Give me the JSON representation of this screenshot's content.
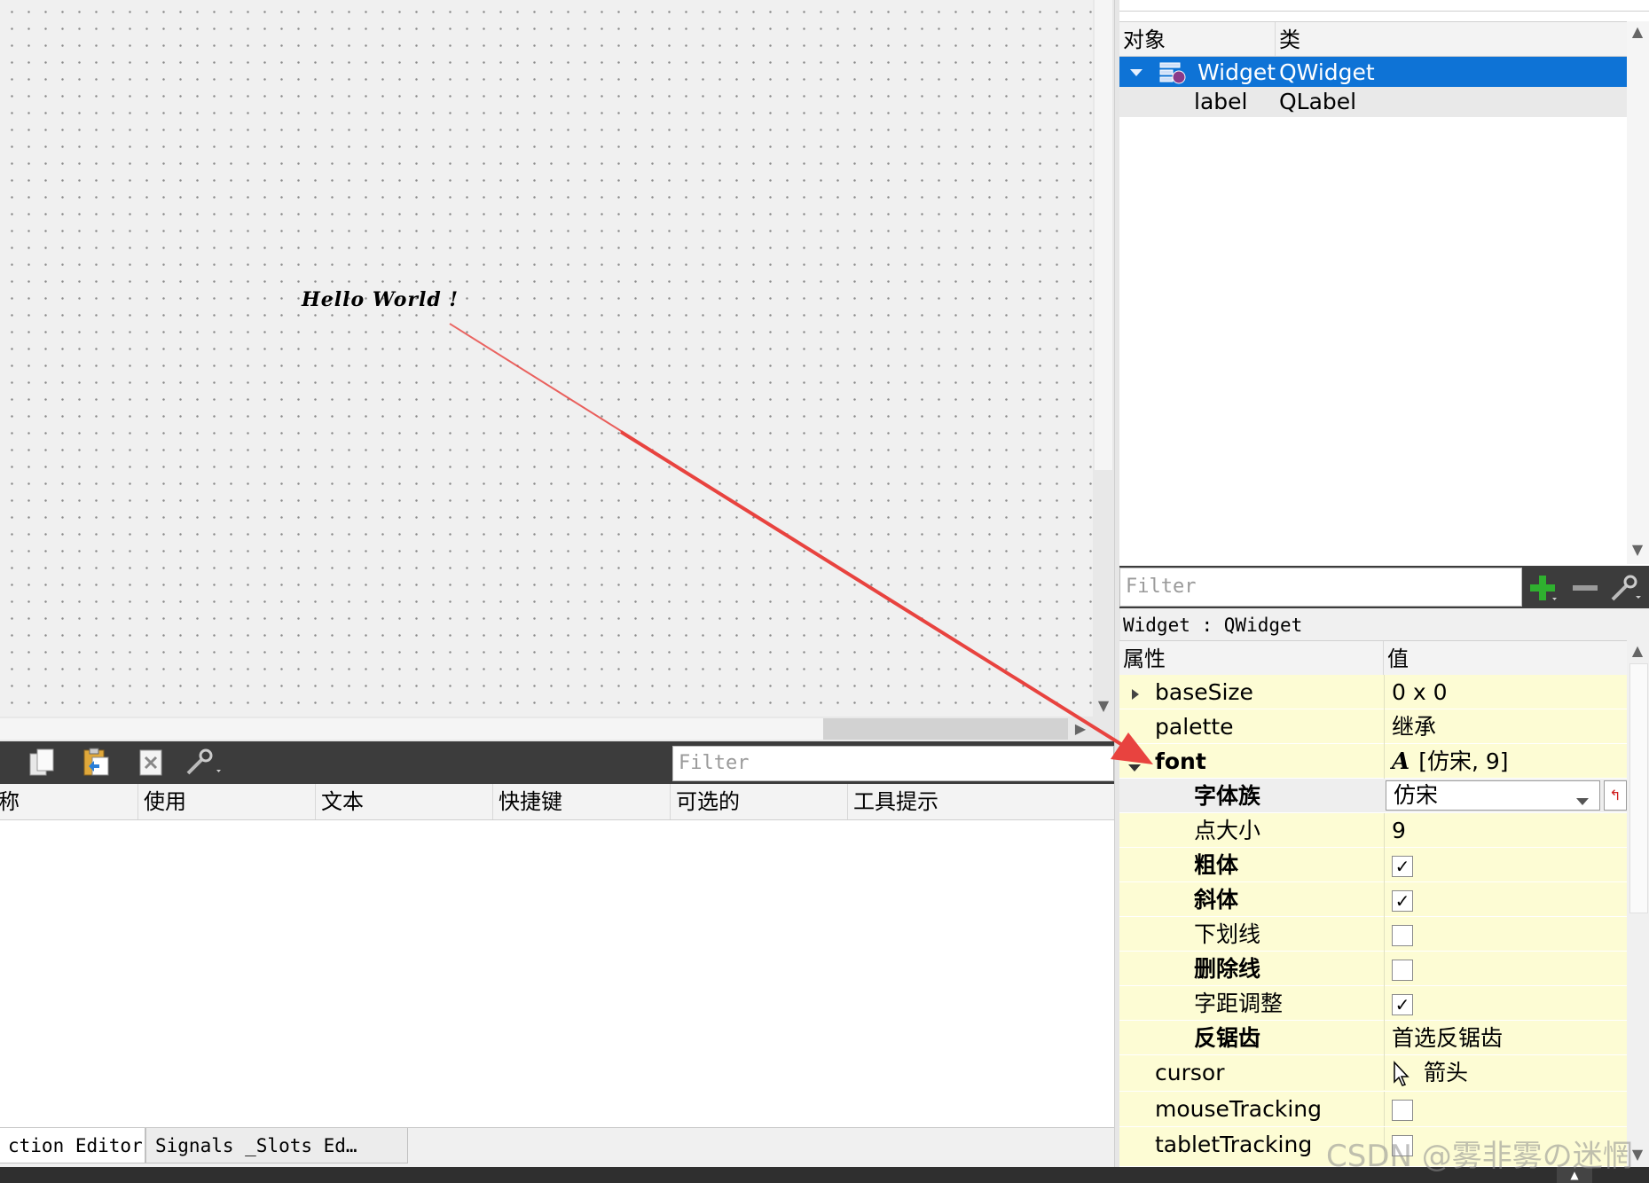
{
  "form_canvas": {
    "label_text": "Hello World !"
  },
  "action_editor": {
    "filter_placeholder": "Filter",
    "columns": [
      "称",
      "使用",
      "文本",
      "快捷键",
      "可选的",
      "工具提示"
    ],
    "toolbar_icons": [
      "copy-icon",
      "paste-icon",
      "delete-icon",
      "wrench-icon"
    ],
    "tabs": [
      "ction Editor",
      "Signals _Slots Ed…"
    ]
  },
  "object_inspector": {
    "columns": [
      "对象",
      "类"
    ],
    "rows": [
      {
        "object": "Widget",
        "class": "QWidget",
        "selected": true
      },
      {
        "object": "label",
        "class": "QLabel",
        "selected": false
      }
    ]
  },
  "property_editor": {
    "filter_placeholder": "Filter",
    "class_label": "Widget : QWidget",
    "columns": [
      "属性",
      "值"
    ],
    "properties": [
      {
        "name": "baseSize",
        "value": "0 x 0"
      },
      {
        "name": "palette",
        "value": "继承"
      },
      {
        "name": "font",
        "value": "[仿宋, 9]"
      },
      {
        "name": "字体族",
        "value": "仿宋"
      },
      {
        "name": "点大小",
        "value": "9"
      },
      {
        "name": "粗体",
        "checked": true
      },
      {
        "name": "斜体",
        "checked": true
      },
      {
        "name": "下划线",
        "checked": false
      },
      {
        "name": "删除线",
        "checked": false
      },
      {
        "name": "字距调整",
        "checked": true
      },
      {
        "name": "反锯齿",
        "value": "首选反锯齿"
      },
      {
        "name": "cursor",
        "value": "箭头"
      },
      {
        "name": "mouseTracking",
        "checked": false
      },
      {
        "name": "tabletTracking",
        "checked": false
      }
    ]
  },
  "watermark": "CSDN @雾非雾の迷惘",
  "colors": {
    "selection": "#0e73d6",
    "property_row": "#fdfcd4",
    "toolbar_bg": "#3c3c3c",
    "annotation_arrow": "#e8433f"
  }
}
